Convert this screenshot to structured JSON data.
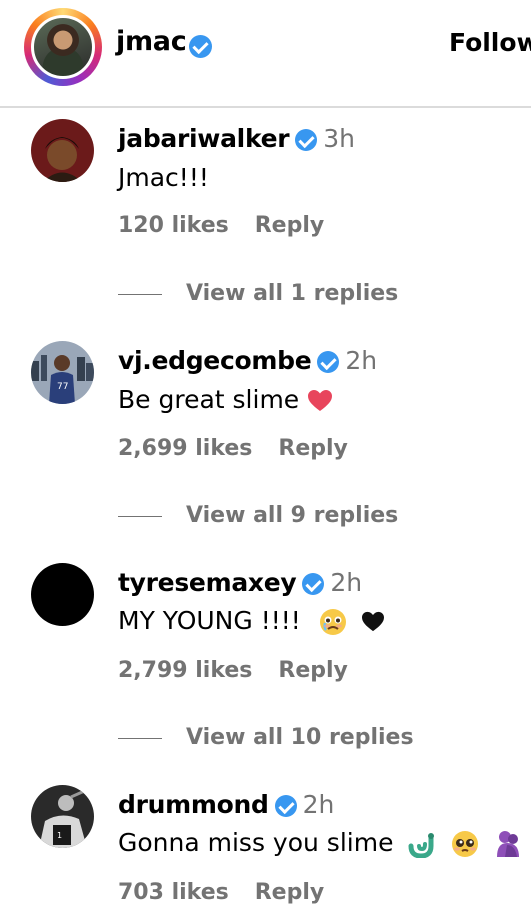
{
  "header": {
    "username": "jmac",
    "follow_label": "Follow"
  },
  "comments": [
    {
      "username": "jabariwalker",
      "time": "3h",
      "text": "Jmac!!!",
      "likes": "120 likes",
      "reply_label": "Reply",
      "view_replies": "View all 1 replies"
    },
    {
      "username": "vj.edgecombe",
      "time": "2h",
      "text": "Be great slime",
      "likes": "2,699 likes",
      "reply_label": "Reply",
      "view_replies": "View all 9 replies"
    },
    {
      "username": "tyresemaxey",
      "time": "2h",
      "text": "MY YOUNG !!!!",
      "likes": "2,799 likes",
      "reply_label": "Reply",
      "view_replies": "View all 10 replies"
    },
    {
      "username": "drummond",
      "time": "2h",
      "text": "Gonna miss you slime",
      "likes": "703 likes",
      "reply_label": "Reply"
    }
  ],
  "colors": {
    "verified": "#3897f0",
    "secondary_text": "#737373",
    "divider": "#dbdbdb"
  }
}
